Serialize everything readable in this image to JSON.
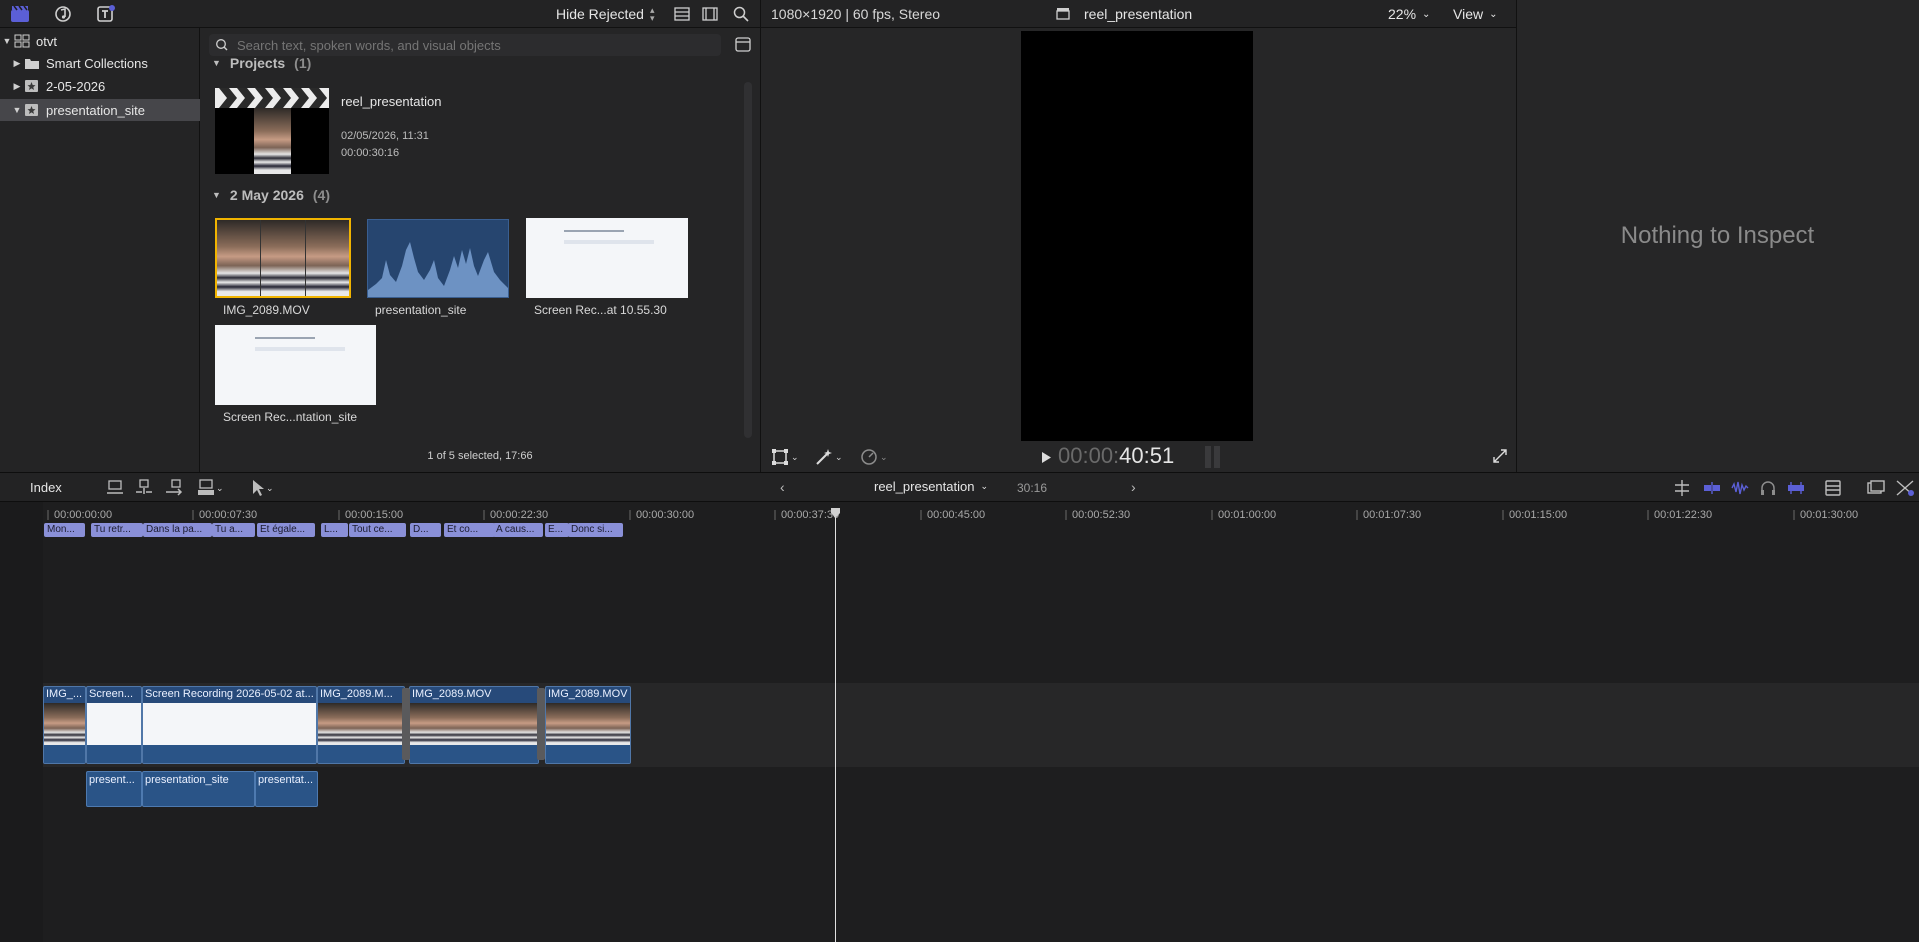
{
  "top_left": {
    "icons": [
      "clapper-icon",
      "music-icon",
      "titles-icon"
    ]
  },
  "browser_header": {
    "filter_label": "Hide Rejected"
  },
  "viewer_header": {
    "format": "1080×1920 | 60 fps, Stereo",
    "project": "reel_presentation",
    "zoom": "22%",
    "view_label": "View"
  },
  "library": {
    "items": [
      {
        "label": "otvt",
        "expanded": true
      },
      {
        "label": "Smart Collections",
        "expanded": false
      },
      {
        "label": "2-05-2026",
        "expanded": false
      },
      {
        "label": "presentation_site",
        "expanded": true,
        "selected": true
      }
    ]
  },
  "search": {
    "placeholder": "Search text, spoken words, and visual objects"
  },
  "browser": {
    "projects_section": {
      "label": "Projects",
      "count": "(1)"
    },
    "project": {
      "name": "reel_presentation",
      "date": "02/05/2026, 11:31",
      "duration": "00:00:30:16"
    },
    "event_section": {
      "label": "2 May 2026",
      "count": "(4)"
    },
    "clips": [
      {
        "name": "IMG_2089.MOV"
      },
      {
        "name": "presentation_site"
      },
      {
        "name": "Screen Rec...at 10.55.30"
      },
      {
        "name": "Screen Rec...ntation_site"
      }
    ],
    "status": "1 of 5 selected, 17:66"
  },
  "viewer": {
    "timecode_dim": "00:00:",
    "timecode_bright": "40:51"
  },
  "inspector": {
    "empty_message": "Nothing to Inspect"
  },
  "timeline_bar": {
    "index_label": "Index",
    "project": "reel_presentation",
    "duration": "30:16"
  },
  "ruler": {
    "labels": [
      "00:00:00:00",
      "00:00:07:30",
      "00:00:15:00",
      "00:00:22:30",
      "00:00:30:00",
      "00:00:37:30",
      "00:00:45:00",
      "00:00:52:30",
      "00:01:00:00",
      "00:01:07:30",
      "00:01:15:00",
      "00:01:22:30",
      "00:01:30:00"
    ]
  },
  "captions": [
    "Mon...",
    "Tu retr...",
    "Dans la pa...",
    "Tu a...",
    "Et égale...",
    "L...",
    "Tout ce...",
    "D...",
    "Et co...",
    "A caus...",
    "E...",
    "Donc si..."
  ],
  "primary_clips": [
    "IMG_...",
    "Screen...",
    "Screen Recording 2026-05-02 at...",
    "IMG_2089.M...",
    "IMG_2089.MOV",
    "IMG_2089.MOV"
  ],
  "audio_clips": [
    "present...",
    "presentation_site",
    "presentat..."
  ],
  "colors": {
    "accent": "#5b5fd6",
    "clip_blue": "#274a7a",
    "caption_purple": "#8a90d8",
    "selection_yellow": "#f1b400"
  }
}
